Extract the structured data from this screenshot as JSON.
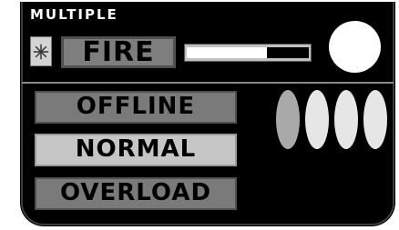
{
  "header": {
    "title": "MULTIPLE"
  },
  "mode": {
    "label": "FIRE",
    "icon": "snowflake-icon"
  },
  "slider": {
    "value": 0.66
  },
  "states": {
    "offline": "OFFLINE",
    "normal": "NORMAL",
    "overload": "OVERLOAD"
  },
  "indicators": [
    "#a9a9a9",
    "#e6e6e6",
    "#e6e6e6",
    "#e6e6e6"
  ]
}
